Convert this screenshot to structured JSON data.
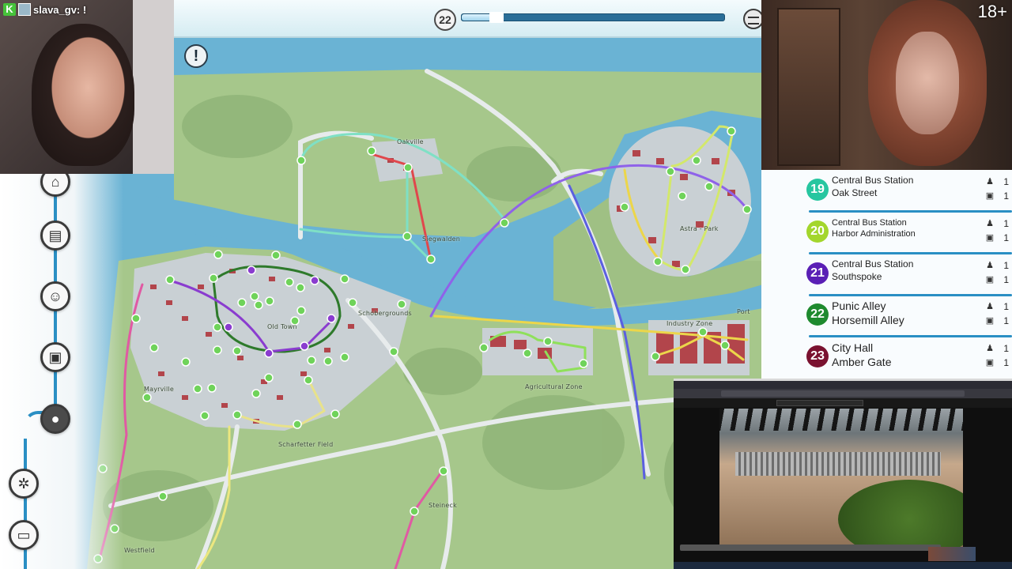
{
  "game": {
    "current_line_number": "22",
    "progress_fraction": 0.16,
    "alert_glyph": "!",
    "coin_icon": "coins-icon",
    "alert_icon": "alert-icon"
  },
  "map_labels": {
    "oakville": "Oakville",
    "siegwalden": "Siegwalden",
    "old_town": "Old Town",
    "schober": "Schobergrounds",
    "astra_park": "Astra - Park",
    "industry_zone": "Industry Zone",
    "agricultural_zone": "Agricultural Zone",
    "mayrville": "Mayrville",
    "scharfetter_field": "Scharfetter Field",
    "steineck": "Steineck",
    "westfield": "Westfield",
    "port": "Port"
  },
  "sidebar_menu": [
    {
      "name": "city-icon",
      "glyph": "⌂"
    },
    {
      "name": "map-icon",
      "glyph": "▤"
    },
    {
      "name": "driver-icon",
      "glyph": "☺"
    },
    {
      "name": "bus-icon",
      "glyph": "▣"
    },
    {
      "name": "people-icon",
      "glyph": "●"
    },
    {
      "name": "gears-icon",
      "glyph": "✲"
    },
    {
      "name": "monitor-icon",
      "glyph": "▭"
    }
  ],
  "stream": {
    "username": "slava_gv: !",
    "k_badge": "K",
    "age_rating": "18+"
  },
  "lines": [
    {
      "number": "19",
      "stop1": "Central Bus Station",
      "stop2": "Oak Street",
      "drivers": "1",
      "buses": "1",
      "color": "#27c6a0",
      "size": "small"
    },
    {
      "number": "20",
      "stop1": "Central Bus Station",
      "stop2": "Harbor Administration",
      "drivers": "1",
      "buses": "1",
      "color": "#a3d62c",
      "size": "small"
    },
    {
      "number": "21",
      "stop1": "Central Bus Station",
      "stop2": "Southspoke",
      "drivers": "1",
      "buses": "1",
      "color": "#5a1fb5",
      "size": "small"
    },
    {
      "number": "22",
      "stop1": "Punic Alley",
      "stop2": "Horsemill Alley",
      "drivers": "1",
      "buses": "1",
      "color": "#1e8a2e",
      "size": "big"
    },
    {
      "number": "23",
      "stop1": "City Hall",
      "stop2": "Amber Gate",
      "drivers": "1",
      "buses": "1",
      "color": "#7a1230",
      "size": "big"
    }
  ],
  "colors": {
    "water": "#6ab3d4",
    "land": "#a6c78b",
    "accent": "#2a8fc4",
    "stop": "#6fd35a"
  }
}
